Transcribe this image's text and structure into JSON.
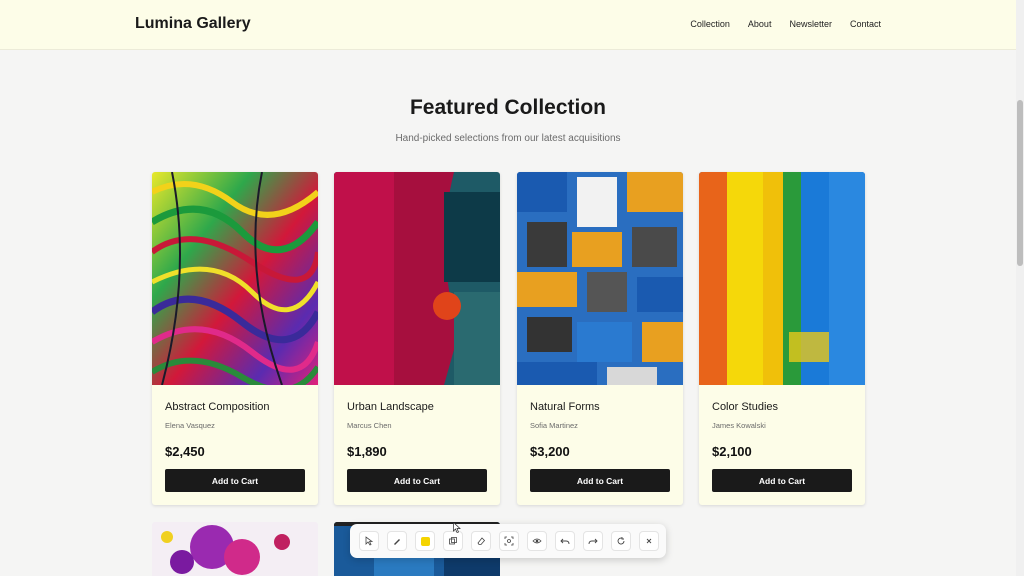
{
  "header": {
    "logo": "Lumina Gallery",
    "nav": [
      "Collection",
      "About",
      "Newsletter",
      "Contact"
    ],
    "background": "#fdfde8"
  },
  "main": {
    "title": "Featured Collection",
    "subtitle": "Hand-picked selections from our latest acquisitions"
  },
  "products": [
    {
      "name": "Abstract Composition",
      "artist": "Elena Vasquez",
      "price": "$2,450",
      "button": "Add to Cart"
    },
    {
      "name": "Urban Landscape",
      "artist": "Marcus Chen",
      "price": "$1,890",
      "button": "Add to Cart"
    },
    {
      "name": "Natural Forms",
      "artist": "Sofia Martinez",
      "price": "$3,200",
      "button": "Add to Cart"
    },
    {
      "name": "Color Studies",
      "artist": "James Kowalski",
      "price": "$2,100",
      "button": "Add to Cart"
    }
  ],
  "toolbar": {
    "tools": [
      "select-icon",
      "pen-icon",
      "color-swatch",
      "shape-icon",
      "eraser-icon",
      "crop-icon",
      "eye-icon",
      "undo-icon",
      "redo-icon",
      "reset-icon",
      "close-icon"
    ],
    "swatch_color": "#f5d400"
  },
  "colors": {
    "button": "#1a1a1a",
    "card": "#fdfde8",
    "page": "#f5f5f4"
  }
}
